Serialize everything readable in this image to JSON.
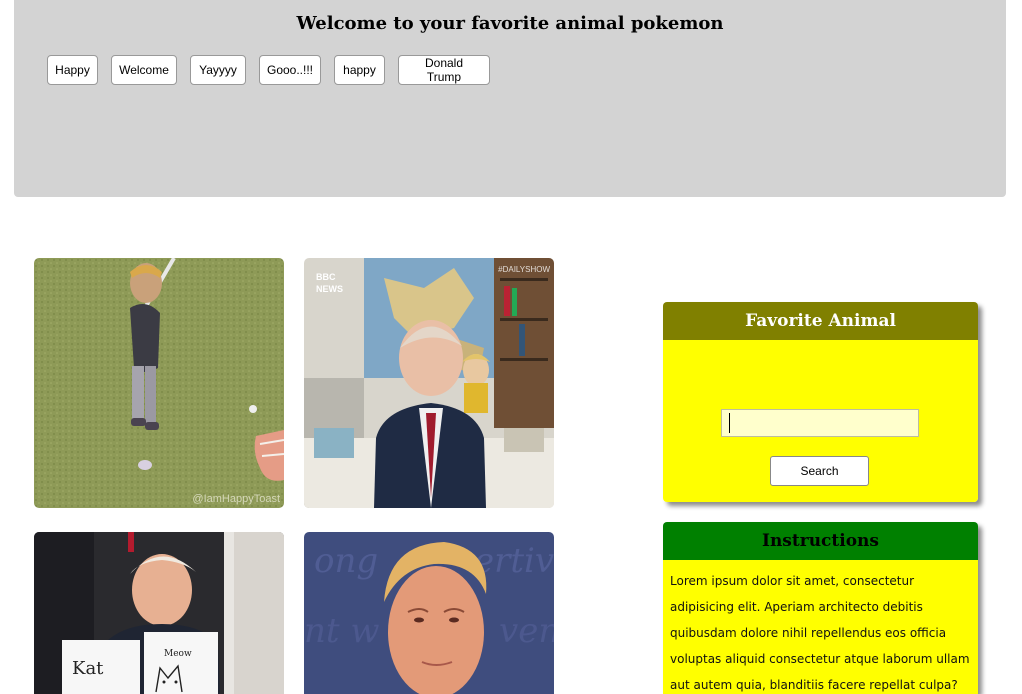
{
  "header": {
    "title": "Welcome to your favorite animal pokemon",
    "buttons": [
      "Happy",
      "Welcome",
      "Yayyyy",
      "Gooo..!!!",
      "happy",
      "Donald Trump"
    ]
  },
  "gifs": {
    "gif1_watermark": "@IamHappyToast",
    "gif2_logo_line1": "BBC",
    "gif2_logo_line2": "NEWS",
    "gif2_tag": "#DAILYSHOW",
    "gif3_sign": "Kat",
    "gif3_sign2": "Meow"
  },
  "favorite": {
    "title": "Favorite Animal",
    "input_value": "",
    "search_label": "Search"
  },
  "instructions": {
    "title": "Instructions",
    "text": "Lorem ipsum dolor sit amet, consectetur adipisicing elit. Aperiam architecto debitis quibusdam dolore nihil repellendus eos officia voluptas aliquid consectetur atque laborum ullam aut autem quia, blanditiis facere repellat culpa?"
  },
  "colors": {
    "header_bg": "#d3d3d3",
    "fav_header": "#808000",
    "instr_header": "#008000",
    "card_body": "#ffff00",
    "fav_title_text": "#ffffff",
    "instr_title_text": "#000000"
  }
}
